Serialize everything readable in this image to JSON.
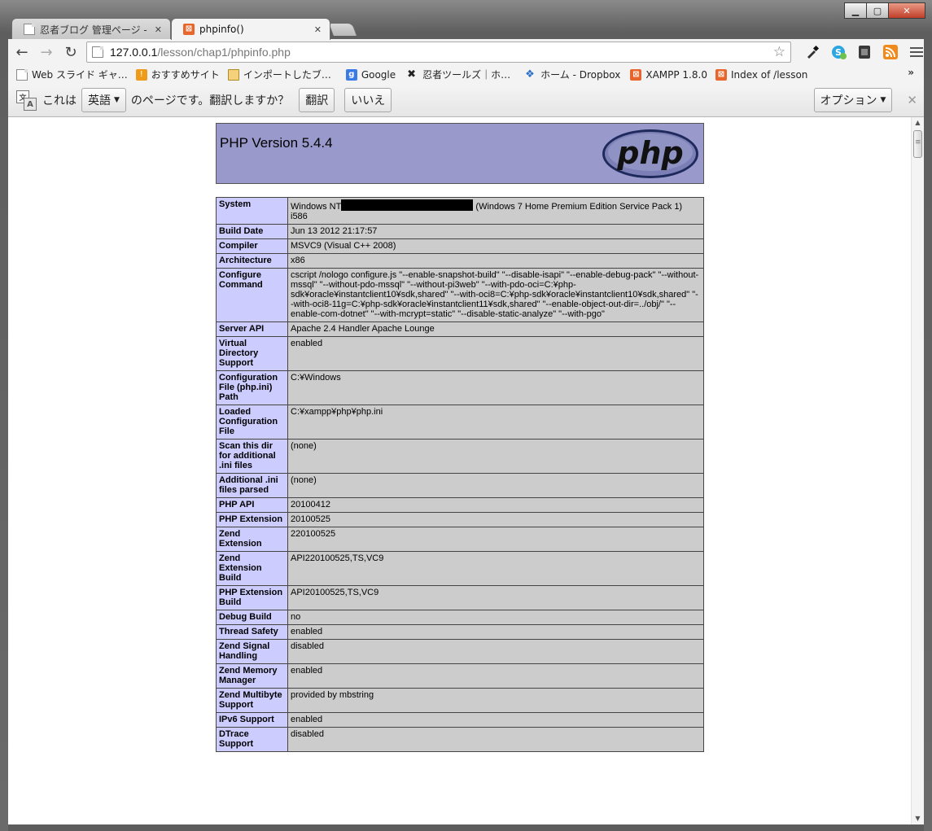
{
  "window": {
    "minimize_icon": "minimize-icon",
    "maximize_icon": "maximize-icon",
    "close_icon": "close-icon"
  },
  "tabs": [
    {
      "title": "忍者ブログ 管理ページ - 忍",
      "active": false
    },
    {
      "title": "phpinfo()",
      "active": true
    }
  ],
  "toolbar": {
    "url_host": "127.0.0.1",
    "url_path": "/lesson/chap1/phpinfo.php"
  },
  "bookmarks": [
    {
      "label": "Web スライド ギャ…",
      "icon": "page-icon"
    },
    {
      "label": "おすすめサイト",
      "icon": "osusume-icon"
    },
    {
      "label": "インポートしたブ…",
      "icon": "folder-icon"
    },
    {
      "label": "Google",
      "icon": "google-icon"
    },
    {
      "label": "忍者ツールズ｜ホ…",
      "icon": "ninja-icon"
    },
    {
      "label": "ホーム - Dropbox",
      "icon": "dropbox-icon"
    },
    {
      "label": "XAMPP 1.8.0",
      "icon": "xampp-icon"
    },
    {
      "label": "Index of /lesson",
      "icon": "xampp-icon"
    }
  ],
  "bookmarks_more": "»",
  "infobar": {
    "prefix": "これは",
    "language": "英語",
    "suffix": "のページです。翻訳しますか？",
    "translate_button": "翻訳",
    "no_button": "いいえ",
    "options_button": "オプション"
  },
  "phpinfo": {
    "title": "PHP Version 5.4.4",
    "logo_text": "php",
    "system_prefix": "Windows NT",
    "system_suffix": "(Windows 7 Home Premium Edition Service Pack 1) i586",
    "rows": [
      {
        "key": "Build Date",
        "value": "Jun 13 2012 21:17:57"
      },
      {
        "key": "Compiler",
        "value": "MSVC9 (Visual C++ 2008)"
      },
      {
        "key": "Architecture",
        "value": "x86"
      },
      {
        "key": "Configure Command",
        "value": "cscript /nologo configure.js \"--enable-snapshot-build\" \"--disable-isapi\" \"--enable-debug-pack\" \"--without-mssql\" \"--without-pdo-mssql\" \"--without-pi3web\" \"--with-pdo-oci=C:¥php-sdk¥oracle¥instantclient10¥sdk,shared\" \"--with-oci8=C:¥php-sdk¥oracle¥instantclient10¥sdk,shared\" \"--with-oci8-11g=C:¥php-sdk¥oracle¥instantclient11¥sdk,shared\" \"--enable-object-out-dir=../obj/\" \"--enable-com-dotnet\" \"--with-mcrypt=static\" \"--disable-static-analyze\" \"--with-pgo\""
      },
      {
        "key": "Server API",
        "value": "Apache 2.4 Handler Apache Lounge"
      },
      {
        "key": "Virtual Directory Support",
        "value": "enabled"
      },
      {
        "key": "Configuration File (php.ini) Path",
        "value": "C:¥Windows"
      },
      {
        "key": "Loaded Configuration File",
        "value": "C:¥xampp¥php¥php.ini"
      },
      {
        "key": "Scan this dir for additional .ini files",
        "value": "(none)"
      },
      {
        "key": "Additional .ini files parsed",
        "value": "(none)"
      },
      {
        "key": "PHP API",
        "value": "20100412"
      },
      {
        "key": "PHP Extension",
        "value": "20100525"
      },
      {
        "key": "Zend Extension",
        "value": "220100525"
      },
      {
        "key": "Zend Extension Build",
        "value": "API220100525,TS,VC9"
      },
      {
        "key": "PHP Extension Build",
        "value": "API20100525,TS,VC9"
      },
      {
        "key": "Debug Build",
        "value": "no"
      },
      {
        "key": "Thread Safety",
        "value": "enabled"
      },
      {
        "key": "Zend Signal Handling",
        "value": "disabled"
      },
      {
        "key": "Zend Memory Manager",
        "value": "enabled"
      },
      {
        "key": "Zend Multibyte Support",
        "value": "provided by mbstring"
      },
      {
        "key": "IPv6 Support",
        "value": "enabled"
      },
      {
        "key": "DTrace Support",
        "value": "disabled"
      }
    ],
    "system_key": "System"
  },
  "colors": {
    "header_bg": "#9999cc",
    "key_bg": "#ccccff",
    "value_bg": "#cccccc",
    "xampp_orange": "#e8652c"
  }
}
